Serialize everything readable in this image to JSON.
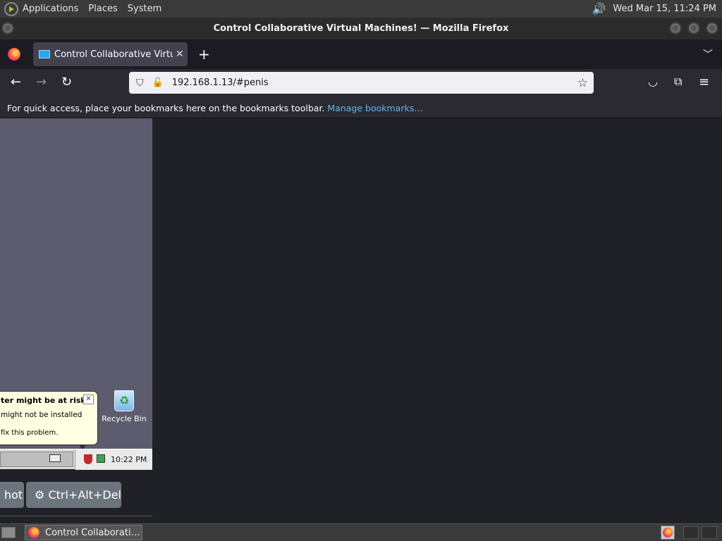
{
  "top_panel": {
    "menus": [
      "Applications",
      "Places",
      "System"
    ],
    "datetime": "Wed Mar 15, 11:24 PM",
    "icons": {
      "distro": "distro-logo-icon",
      "volume": "volume-icon"
    }
  },
  "window": {
    "title": "Control Collaborative Virtual Machines! — Mozilla Firefox"
  },
  "browser": {
    "tab_title": "Control Collaborative Virtual Machines!",
    "tab_close": "✕",
    "new_tab": "+",
    "url": "192.168.1.13/#penis",
    "bookmarks_message": "For quick access, place your bookmarks here on the bookmarks toolbar.",
    "manage_bookmarks": "Manage bookmarks…"
  },
  "vm": {
    "balloon": {
      "title": "ter might be at risk",
      "line1": "might not be installed",
      "line2": "fix this problem.",
      "close": "✕"
    },
    "recycle_bin_label": "Recycle Bin",
    "clock": "10:22 PM",
    "buttons": {
      "screenshot_partial": "hot",
      "ctrl_alt_del": "Ctrl+Alt+Del"
    },
    "colors": {
      "desktop": "#5d5c6e",
      "button": "#6c757d"
    }
  },
  "bottom_panel": {
    "task_title": "Control Collaborati…"
  }
}
